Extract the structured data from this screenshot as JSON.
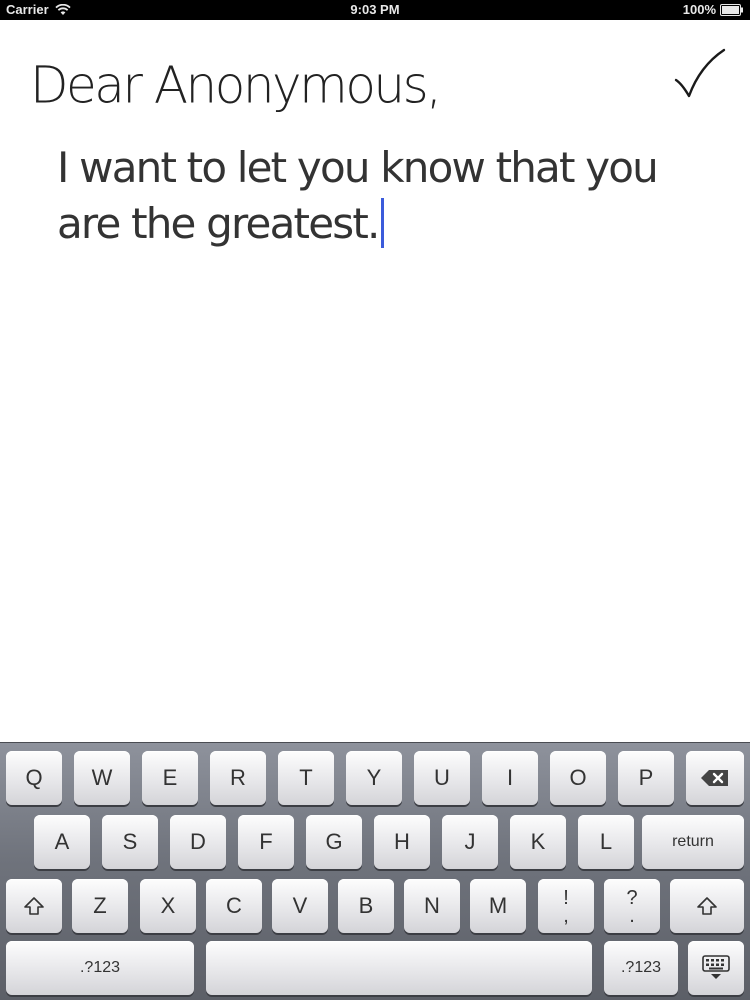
{
  "status_bar": {
    "carrier": "Carrier",
    "time": "9:03 PM",
    "battery": "100%"
  },
  "note": {
    "greeting": "Dear Anonymous,",
    "message_lines": [
      "I want to let you know that you",
      "are the greatest."
    ],
    "done_icon": "checkmark-icon"
  },
  "keyboard": {
    "row1": [
      "Q",
      "W",
      "E",
      "R",
      "T",
      "Y",
      "U",
      "I",
      "O",
      "P"
    ],
    "row2": [
      "A",
      "S",
      "D",
      "F",
      "G",
      "H",
      "J",
      "K",
      "L"
    ],
    "row3": [
      "Z",
      "X",
      "C",
      "V",
      "B",
      "N",
      "M"
    ],
    "punct1": [
      "!",
      ","
    ],
    "punct2": [
      "?",
      "."
    ],
    "return_label": "return",
    "numbers_label": ".?123",
    "backspace_icon": "backspace-icon",
    "shift_icon": "shift-icon",
    "hide_keyboard_icon": "hide-keyboard-icon"
  },
  "colors": {
    "cursor": "#3b5bdb",
    "status_bar_bg": "#000000"
  }
}
